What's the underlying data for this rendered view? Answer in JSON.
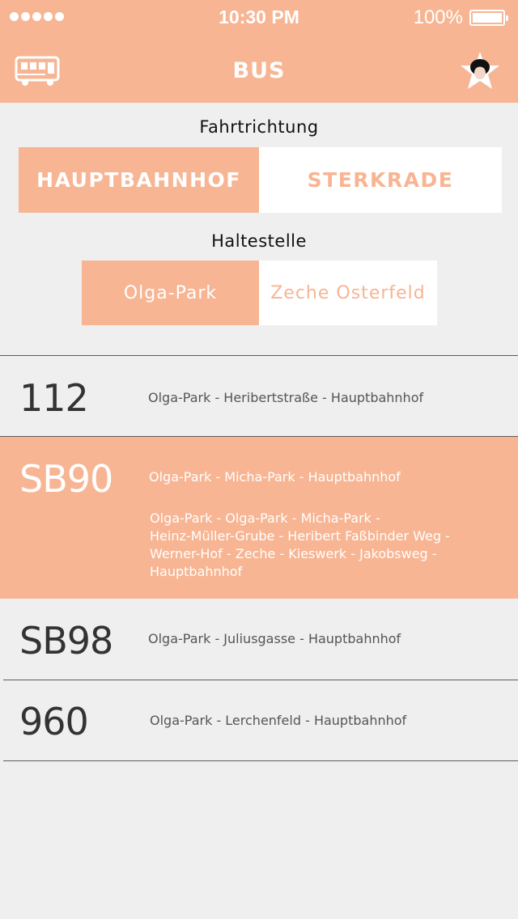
{
  "status_bar": {
    "time": "10:30 PM",
    "battery_percent": "100%",
    "signal_dots": 5
  },
  "navbar": {
    "title": "BUS",
    "left_icon": "bus-icon",
    "right_icon": "profile-star-icon"
  },
  "direction": {
    "label": "Fahrtrichtung",
    "options": [
      "HAUPTBAHNHOF",
      "STERKRADE"
    ],
    "selected": "HAUPTBAHNHOF"
  },
  "stop": {
    "label": "Haltestelle",
    "options": [
      "Olga-Park",
      "Zeche Osterfeld"
    ],
    "selected": "Olga-Park"
  },
  "routes": [
    {
      "number": "112",
      "summary": "Olga-Park - Heribertstraße - Hauptbahnhof"
    },
    {
      "number": "SB90",
      "summary": "Olga-Park - Micha-Park - Hauptbahnhof",
      "details": [
        "Olga-Park - Olga-Park - Micha-Park -",
        "Heinz-Müller-Grube - Heribert Faßbinder Weg -",
        "Werner-Hof - Zeche - Kieswerk - Jakobsweg -",
        "Hauptbahnhof"
      ],
      "expanded": true
    },
    {
      "number": "SB98",
      "summary": "Olga-Park - Juliusgasse - Hauptbahnhof"
    },
    {
      "number": "960",
      "summary": "Olga-Park - Lerchenfeld - Hauptbahnhof"
    }
  ],
  "colors": {
    "accent": "#f7b593",
    "background": "#efefef",
    "text_dark": "#333333"
  }
}
